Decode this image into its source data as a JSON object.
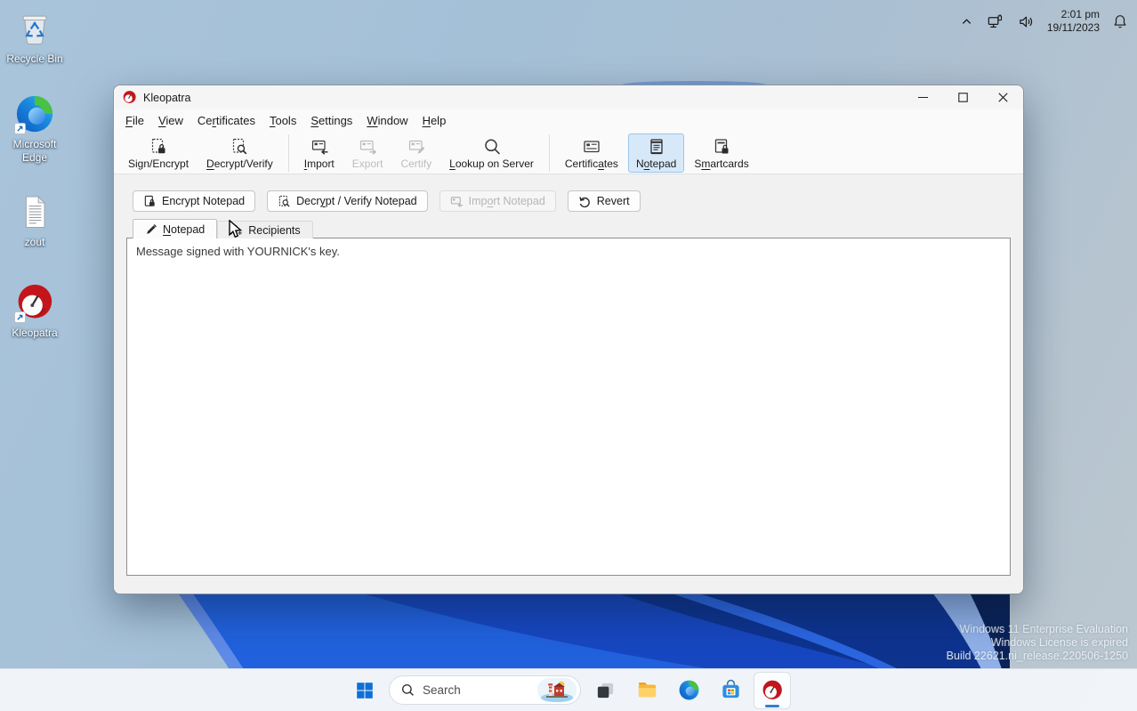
{
  "colors": {
    "accent_blue": "#0b6ad4",
    "toolbar_active_bg": "#d7e9f9",
    "toolbar_active_border": "#9cc5e8",
    "wallpaper_bloom_blue": "#1d57d6",
    "taskbar_bg": "#f2f6fa"
  },
  "desktop": {
    "icons": [
      {
        "name": "recycle-bin",
        "label": "Recycle Bin"
      },
      {
        "name": "microsoft-edge",
        "label": "Microsoft Edge"
      },
      {
        "name": "zout",
        "label": "zout"
      },
      {
        "name": "kleopatra",
        "label": "Kleopatra"
      }
    ],
    "watermark": {
      "line1": "Windows 11 Enterprise Evaluation",
      "line2": "Windows License is expired",
      "line3": "Build 22621.ni_release.220506-1250"
    }
  },
  "window": {
    "title": "Kleopatra",
    "menu": {
      "items": [
        "&File",
        "&View",
        "Ce&rtificates",
        "&Tools",
        "&Settings",
        "&Window",
        "&Help"
      ]
    },
    "toolbar": {
      "items": [
        {
          "label": "Sign/Encrypt",
          "icon": "document-lock-icon",
          "enabled": true,
          "active": false
        },
        {
          "label": "&Decrypt/Verify",
          "icon": "document-search-icon",
          "enabled": true,
          "active": false
        },
        {
          "label": "&Import",
          "icon": "card-arrow-in-icon",
          "enabled": true,
          "active": false
        },
        {
          "label": "Export",
          "icon": "card-arrow-out-icon",
          "enabled": false,
          "active": false
        },
        {
          "label": "Certify",
          "icon": "card-pen-icon",
          "enabled": false,
          "active": false
        },
        {
          "label": "&Lookup on Server",
          "icon": "search-icon",
          "enabled": true,
          "active": false
        },
        {
          "label": "Certific&ates",
          "icon": "id-card-icon",
          "enabled": true,
          "active": false
        },
        {
          "label": "N&otepad",
          "icon": "notepad-icon",
          "enabled": true,
          "active": true
        },
        {
          "label": "S&martcards",
          "icon": "smartcard-reader-icon",
          "enabled": true,
          "active": false
        }
      ]
    },
    "notepad": {
      "actions": [
        {
          "label": "Encrypt Notepad",
          "icon": "document-lock-icon",
          "enabled": true
        },
        {
          "label": "Decr&ypt / Verify Notepad",
          "icon": "document-search-icon",
          "enabled": true
        },
        {
          "label": "Imp&ort Notepad",
          "icon": "card-arrow-in-icon",
          "enabled": false
        },
        {
          "label": "Revert",
          "icon": "undo-icon",
          "enabled": true
        }
      ],
      "tabs": [
        {
          "label": "&Notepad",
          "icon": "pencil-icon",
          "active": true
        },
        {
          "label": "Recipients",
          "icon": "person-add-icon",
          "active": false
        }
      ],
      "content": "Message signed with YOURNICK's key."
    }
  },
  "taskbar": {
    "search_placeholder": "Search",
    "apps": [
      {
        "name": "start"
      },
      {
        "name": "search"
      },
      {
        "name": "task-view"
      },
      {
        "name": "file-explorer"
      },
      {
        "name": "edge"
      },
      {
        "name": "store"
      },
      {
        "name": "kleopatra",
        "active": true
      }
    ]
  },
  "tray": {
    "time": "2:01 pm",
    "date": "19/11/2023"
  }
}
